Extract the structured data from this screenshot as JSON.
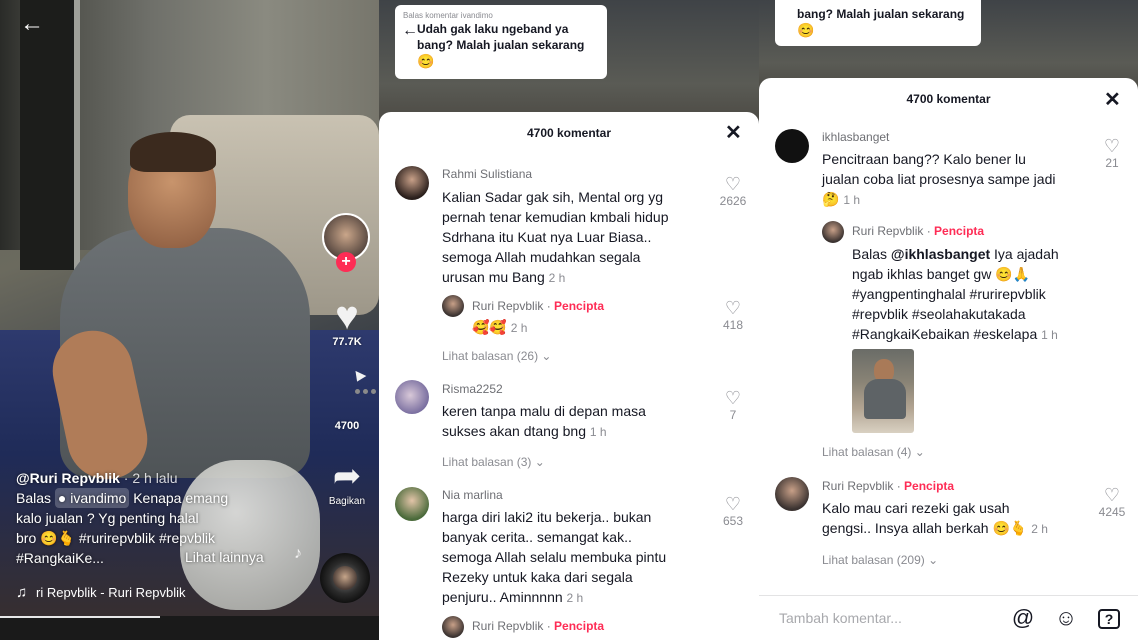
{
  "panel1": {
    "back_icon": "arrow-left-icon",
    "likes": "77.7K",
    "comments": "4700",
    "share_label": "Bagikan",
    "caption": {
      "username": "@Ruri Repvblik",
      "time": "· 2 h lalu",
      "reply_prefix": "Balas",
      "mention": "ivandimo",
      "line1_rest": "Kenapa emang",
      "line2": "kalo jualan ? Yg penting halal",
      "line3": "bro 😊🫰 #rurirepvblik #repvblik",
      "line4": "#RangkaiKe...",
      "more": "Lihat lainnya"
    },
    "music": "ri Repvblik - Ruri Repvblik"
  },
  "panel2": {
    "reply_quote": {
      "label": "Balas komentar ivandimo",
      "text": "Udah gak laku ngeband ya bang? Malah jualan sekarang",
      "emoji": "😊"
    },
    "title": "4700 komentar",
    "comments": [
      {
        "name": "Rahmi Sulistiana",
        "lines": [
          "Kalian Sadar gak sih, Mental org yg",
          "pernah tenar kemudian kmbali hidup",
          "Sdrhana itu Kuat nya Luar Biasa..",
          "semoga Allah mudahkan segala",
          "urusan mu Bang"
        ],
        "time": "2 h",
        "likes": "2626",
        "reply": {
          "name": "Ruri Repvblik",
          "creator": "Pencipta",
          "text": "🥰🥰",
          "time": "2 h",
          "likes": "418"
        },
        "view_replies": "Lihat balasan (26)"
      },
      {
        "name": "Risma2252",
        "lines": [
          "keren tanpa malu di depan masa",
          "sukses akan dtang bng"
        ],
        "time": "1 h",
        "likes": "7",
        "view_replies": "Lihat balasan (3)"
      },
      {
        "name": "Nia marlina",
        "lines": [
          "harga diri laki2 itu bekerja.. bukan",
          "banyak cerita.. semangat kak..",
          "semoga Allah selalu membuka pintu",
          "Rezeky untuk kaka dari segala",
          "penjuru.. Aminnnnn"
        ],
        "time": "2 h",
        "likes": "653"
      }
    ],
    "cut_name": "Ruri Repvblik",
    "cut_creator": "Pencipta"
  },
  "panel3": {
    "reply_quote": {
      "line1": "bang? Malah jualan sekarang",
      "emoji": "😊"
    },
    "title": "4700 komentar",
    "comment1": {
      "name": "ikhlasbanget",
      "lines": [
        "Pencitraan bang?? Kalo bener lu",
        "jualan coba liat prosesnya sampe jadi"
      ],
      "emoji": "🤔",
      "time": "1 h",
      "likes": "21"
    },
    "reply1": {
      "name": "Ruri Repvblik",
      "creator": "Pencipta",
      "prefix": "Balas",
      "mention": "@ikhlasbanget",
      "line1_rest": "Iya ajadah",
      "lines": [
        "ngab ikhlas banget gw 😊🙏",
        "#yangpentinghalal #rurirepvblik",
        "#repvblik #seolahakutakada",
        "#RangkaiKebaikan #eskelapa"
      ],
      "time": "1 h"
    },
    "view_replies1": "Lihat balasan (4)",
    "comment2": {
      "name": "Ruri Repvblik",
      "creator": "Pencipta",
      "lines": [
        "Kalo mau cari rezeki gak usah",
        "gengsi.. Insya allah berkah 😊🫰"
      ],
      "time": "2 h",
      "likes": "4245"
    },
    "view_replies2": "Lihat balasan (209)",
    "input_placeholder": "Tambah komentar...",
    "icons": [
      "at-icon",
      "emoji-icon",
      "question-sticker-icon"
    ]
  },
  "colors": {
    "accent": "#fe2c55",
    "text": "#161823",
    "muted": "#8a8b91"
  }
}
